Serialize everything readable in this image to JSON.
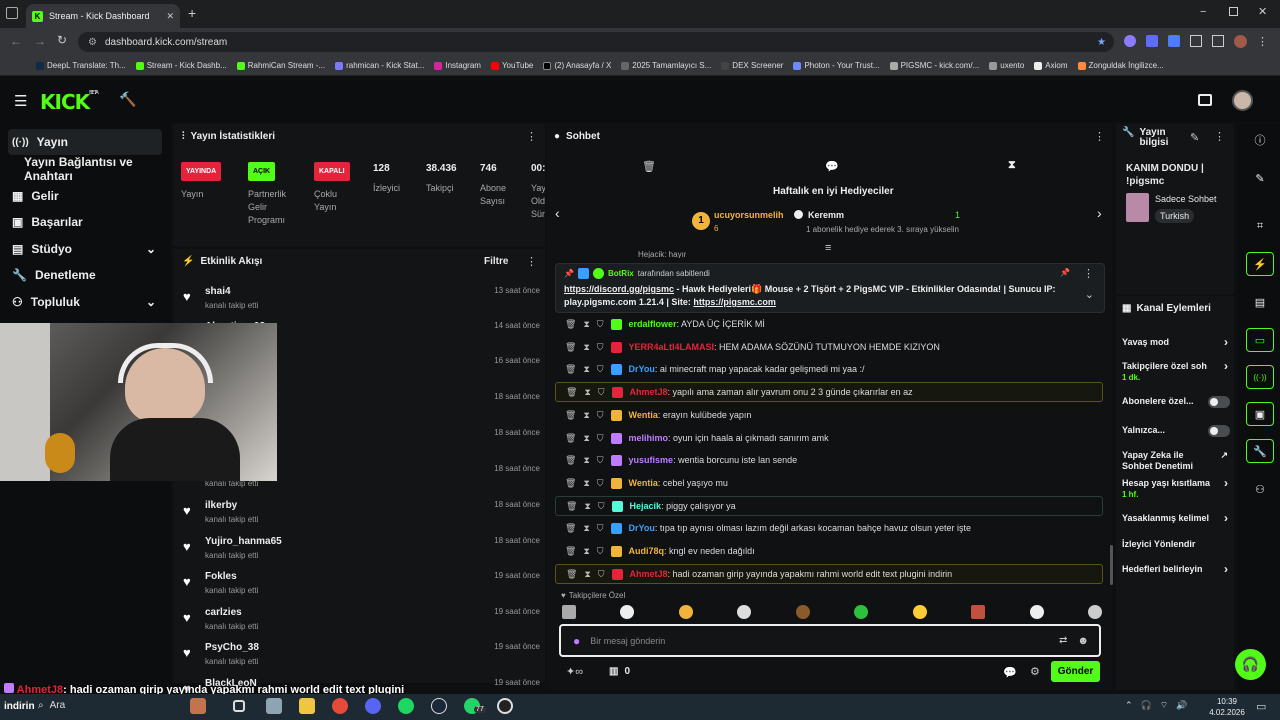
{
  "browser": {
    "tab_title": "Stream - Kick Dashboard",
    "url": "dashboard.kick.com/stream",
    "bookmarks": [
      "DeepL Translate: Th...",
      "Stream - Kick Dashb...",
      "RahmiCan Stream -...",
      "rahmican - Kick Stat...",
      "Instagram",
      "YouTube",
      "(2) Anasayfa / X",
      "2025 Tamamlayıcı S...",
      "DEX Screener",
      "Photon - Your Trust...",
      "PIGSMC - kick.com/...",
      "uxento",
      "Axiom",
      "Zonguldak İngilizce..."
    ]
  },
  "kick": {
    "logo": "KICK",
    "logo_sup": "BETA"
  },
  "nav": {
    "items": [
      {
        "label": "Yayın"
      },
      {
        "label": "Yayın Bağlantısı ve Anahtarı"
      },
      {
        "label": "Gelir"
      },
      {
        "label": "Başarılar"
      },
      {
        "label": "Stüdyo"
      },
      {
        "label": "Denetleme"
      },
      {
        "label": "Topluluk"
      }
    ]
  },
  "stats": {
    "title": "Yayın İstatistikleri",
    "badges": [
      {
        "text": "YAYINDA",
        "label": "Yayın",
        "color": "#e5243b"
      },
      {
        "text": "AÇIK",
        "label": "Partnerlik Gelir Programı",
        "color": "#53fc18"
      },
      {
        "text": "KAPALI",
        "label": "Çoklu Yayın",
        "color": "#e5243b"
      }
    ],
    "numbers": [
      {
        "value": "128",
        "label": "İzleyici"
      },
      {
        "value": "38.436",
        "label": "Takipçi"
      },
      {
        "value": "746",
        "label": "Abone Sayısı"
      },
      {
        "value": "00:",
        "label": "Yay Old Sür"
      }
    ]
  },
  "activity": {
    "title": "Etkinlik Akışı",
    "filter": "Filtre",
    "items": [
      {
        "name": "shai4",
        "sub": "kanalı takip etti",
        "time": "13 saat önce"
      },
      {
        "name": "Alpertinc_08",
        "sub": "kanalı takip etti",
        "time": "14 saat önce"
      },
      {
        "name": "",
        "sub": "",
        "time": "16 saat önce"
      },
      {
        "name": "...DI_AP0",
        "sub": "",
        "time": "18 saat önce"
      },
      {
        "name": "",
        "sub": "",
        "time": "18 saat önce"
      },
      {
        "name": "",
        "sub": "kanalı takip etti",
        "time": "18 saat önce"
      },
      {
        "name": "ilkerby",
        "sub": "kanalı takip etti",
        "time": "18 saat önce"
      },
      {
        "name": "Yujiro_hanma65",
        "sub": "kanalı takip etti",
        "time": "18 saat önce"
      },
      {
        "name": "Fokles",
        "sub": "kanalı takip etti",
        "time": "19 saat önce"
      },
      {
        "name": "carlzies",
        "sub": "kanalı takip etti",
        "time": "19 saat önce"
      },
      {
        "name": "PsyCho_38",
        "sub": "kanalı takip etti",
        "time": "19 saat önce"
      },
      {
        "name": "BlackLeoN",
        "sub": "",
        "time": "19 saat önce"
      }
    ]
  },
  "chat": {
    "title": "Sohbet",
    "gifters_title": "Haftalık en iyi Hediyeciler",
    "gifter1": {
      "rank": "1",
      "name": "ucuyorsunmelih",
      "count": "6"
    },
    "gifter2": {
      "name": "Keremm",
      "count": "1",
      "note": "1 abonelik hediye ederek 3. sıraya yükselin"
    },
    "pinned": {
      "by": "BotRix",
      "by_suffix": "tarafından sabitlendi",
      "link1": "https://discord.gg/pigsmc",
      "text": " - Hawk Hediyeleri🎁 Mouse + 2 Tişört + 2 PigsMC VIP - Etkinlikler Odasında! | Sunucu IP: play.pigsmc.com 1.21.4 | Site: ",
      "link2": "https://pigsmc.com"
    },
    "partial_user": "Hejacik: hayır",
    "messages": [
      {
        "user": "erdalflower",
        "color": "#53fc18",
        "text": ": AYDA ÜÇ İÇERİK Mİ",
        "hl": ""
      },
      {
        "user": "YERR4aLtI4LAMASI",
        "color": "#e5243b",
        "text": ": HEM ADAMA SÖZÜNÜ TUTMUYON HEMDE KIZIYON",
        "hl": ""
      },
      {
        "user": "DrYou",
        "color": "#3aa0ff",
        "text": ": ai minecraft map yapacak kadar gelişmedi mi yaa :/",
        "hl": ""
      },
      {
        "user": "AhmetJ8",
        "color": "#e5243b",
        "text": ": yapılı ama zaman alır yavrum onu 2 3 günde çıkarırlar en az",
        "hl": "hl"
      },
      {
        "user": "Wentia",
        "color": "#f0b43c",
        "text": ": erayın kulübede yapın",
        "hl": ""
      },
      {
        "user": "melihimo",
        "color": "#c07cff",
        "text": ": oyun için haala ai çıkmadı sanırım amk",
        "hl": ""
      },
      {
        "user": "yusufisme",
        "color": "#c07cff",
        "text": ": wentia borcunu iste lan sende",
        "hl": ""
      },
      {
        "user": "Wentia",
        "color": "#f0b43c",
        "text": ": cebel yaşıyo mu",
        "hl": ""
      },
      {
        "user": "Hejacik",
        "color": "#53fcd8",
        "text": ": piggy çalışıyor ya",
        "hl": "hlb"
      },
      {
        "user": "DrYou",
        "color": "#3aa0ff",
        "text": ": tıpa tıp aynısı olması lazım değil arkası kocaman bahçe havuz olsun yeter işte",
        "hl": ""
      },
      {
        "user": "Audi78q",
        "color": "#f0b43c",
        "text": ": kngl ev neden dağıldı",
        "hl": ""
      },
      {
        "user": "AhmetJ8",
        "color": "#e5243b",
        "text": ": hadi ozaman girip yayında yapakmı rahmi world edit text plugini indirin",
        "hl": "hl"
      }
    ],
    "followers_only": "Takipçilere Özel",
    "input_placeholder": "Bir mesaj gönderin",
    "points": "0",
    "send": "Gönder"
  },
  "stream_info": {
    "title": "Yayın bilgisi",
    "stream_title": "KANIM DONDU | !pigsmc",
    "category": "Sadece Sohbet",
    "language": "Turkish"
  },
  "channel_actions": {
    "title": "Kanal Eylemleri",
    "items": [
      {
        "label": "Yavaş mod",
        "sub": "",
        "type": "chevron"
      },
      {
        "label": "Takipçilere özel soh",
        "sub": "1 dk.",
        "type": "chevron"
      },
      {
        "label": "Abonelere özel...",
        "sub": "",
        "type": "toggle"
      },
      {
        "label": "Yalnızca...",
        "sub": "",
        "type": "toggle"
      },
      {
        "label": "Yapay Zeka ile Sohbet Denetimi",
        "sub": "",
        "type": "external"
      },
      {
        "label": "Hesap yaşı kısıtlama",
        "sub": "1 hf.",
        "type": "chevron"
      },
      {
        "label": "Yasaklanmış kelimel",
        "sub": "",
        "type": "chevron"
      },
      {
        "label": "İzleyici Yönlendir",
        "sub": "",
        "type": "none"
      },
      {
        "label": "Hedefleri belirleyin",
        "sub": "",
        "type": "chevron"
      }
    ]
  },
  "overlay": {
    "user": "AhmetJ8",
    "text": ": hadi ozaman girip yayında yapakmı rahmi world edit text plugini",
    "text2": "indirin"
  },
  "taskbar": {
    "search": "Ara",
    "time": "10:39",
    "date": "4.02.2026",
    "badge": "77"
  },
  "colors": {
    "kick_green": "#53fc18",
    "live_red": "#e5243b"
  }
}
